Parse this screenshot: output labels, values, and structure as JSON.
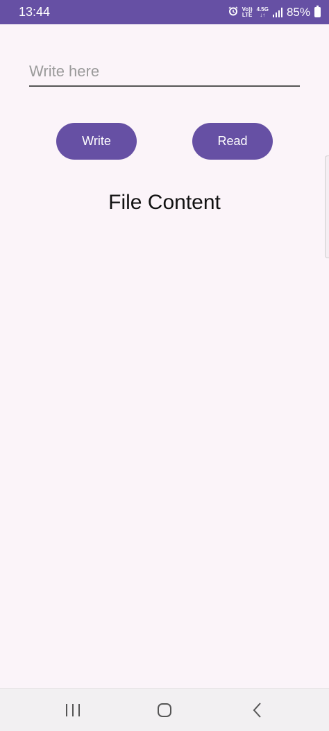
{
  "status_bar": {
    "time": "13:44",
    "volte_top": "Vo))",
    "volte_bottom": "LTE",
    "network_top": "4.5G",
    "network_bottom": "↓↑",
    "battery": "85%",
    "icons": [
      "alarm-icon",
      "signal-icon",
      "battery-icon"
    ]
  },
  "input": {
    "placeholder": "Write here",
    "value": ""
  },
  "buttons": {
    "write_label": "Write",
    "read_label": "Read"
  },
  "content": {
    "title": "File Content"
  },
  "nav": {
    "icons": [
      "recents-icon",
      "home-icon",
      "back-icon"
    ]
  },
  "colors": {
    "accent": "#6650a4",
    "background": "#fbf4f9",
    "nav_background": "#f2f0f2"
  }
}
